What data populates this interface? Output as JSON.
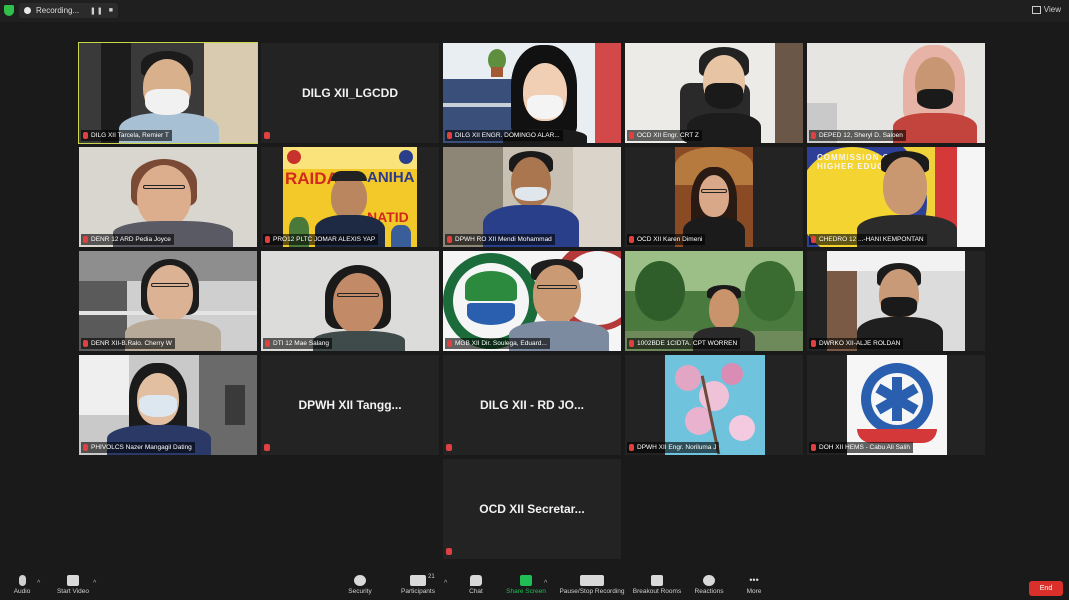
{
  "topbar": {
    "recording_label": "Recording...",
    "view_label": "View"
  },
  "tiles": [
    {
      "name": "DILG XII Tarcela, Remier T",
      "big": ""
    },
    {
      "name": "",
      "big": "DILG XII_LGCDD"
    },
    {
      "name": "DILG XII ENGR. DOMINGO ALAR...",
      "big": ""
    },
    {
      "name": "OCD XII Engr. CRT Z",
      "big": ""
    },
    {
      "name": "DEPED 12, Sheryl D. Saloen",
      "big": ""
    },
    {
      "name": "DENR 12 ARD Pedia Joyce",
      "big": ""
    },
    {
      "name": "PRO12 PLTC JOMAR ALEXIS YAP",
      "big": ""
    },
    {
      "name": "DPWH RO XII Mendi Mohammad",
      "big": ""
    },
    {
      "name": "OCD XII Karen Dimeni",
      "big": ""
    },
    {
      "name": "CHEDRO 12 ...-HANI KEMPONTAN",
      "big": ""
    },
    {
      "name": "DENR XII-B.Ralo. Cherry W",
      "big": ""
    },
    {
      "name": "DTI 12 Mae Salang",
      "big": ""
    },
    {
      "name": "MGB XII Dir. Soulega, Eduard...",
      "big": ""
    },
    {
      "name": "1002BDE 1CIDTA. CPT WORREN",
      "big": ""
    },
    {
      "name": "DWRKO XII-ALJE ROLDAN",
      "big": ""
    },
    {
      "name": "PHIVOLCS Nazer Mangagil Dating",
      "big": ""
    },
    {
      "name": "",
      "big": "DPWH XII Tangg..."
    },
    {
      "name": "",
      "big": "DILG XII - RD JO..."
    },
    {
      "name": "DPWH XII Engr. Noriluma J",
      "big": ""
    },
    {
      "name": "DOH XII HEMS - Cabu Ali Salih",
      "big": ""
    },
    {
      "name": "",
      "big": "OCD XII Secretar..."
    }
  ],
  "banner": {
    "raiday_text": "RAIDAY",
    "aniha_text": "ANIHA",
    "natid_text": "NATID"
  },
  "seal_text": "COMMISSION ON HIGHER EDUCATION",
  "toolbar": {
    "audio": "Audio",
    "video": "Start Video",
    "security": "Security",
    "participants": "Participants",
    "participants_count": "21",
    "chat": "Chat",
    "share": "Share Screen",
    "record": "Pause/Stop Recording",
    "breakout": "Breakout Rooms",
    "reactions": "Reactions",
    "more": "More",
    "end": "End"
  }
}
